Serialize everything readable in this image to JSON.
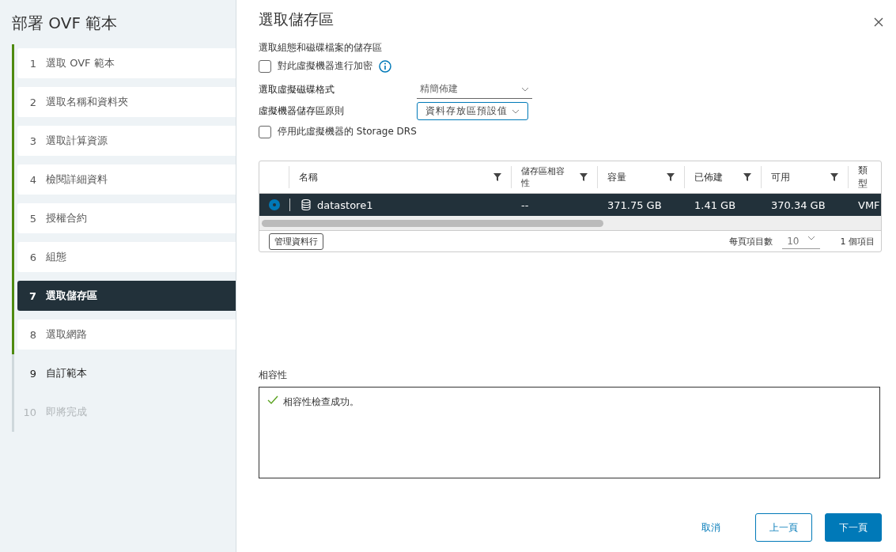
{
  "sidebar": {
    "title": "部署 OVF 範本",
    "steps": [
      {
        "number": "1",
        "label": "選取 OVF 範本",
        "completed": true,
        "selected": false,
        "disabled": false
      },
      {
        "number": "2",
        "label": "選取名稱和資料夾",
        "completed": true,
        "selected": false,
        "disabled": false
      },
      {
        "number": "3",
        "label": "選取計算資源",
        "completed": true,
        "selected": false,
        "disabled": false
      },
      {
        "number": "4",
        "label": "檢閱詳細資料",
        "completed": true,
        "selected": false,
        "disabled": false
      },
      {
        "number": "5",
        "label": "授權合約",
        "completed": true,
        "selected": false,
        "disabled": false
      },
      {
        "number": "6",
        "label": "組態",
        "completed": true,
        "selected": false,
        "disabled": false
      },
      {
        "number": "7",
        "label": "選取儲存區",
        "completed": true,
        "selected": true,
        "disabled": false
      },
      {
        "number": "8",
        "label": "選取網路",
        "completed": true,
        "selected": false,
        "disabled": false
      },
      {
        "number": "9",
        "label": "自訂範本",
        "completed": false,
        "selected": false,
        "disabled": false
      },
      {
        "number": "10",
        "label": "即將完成",
        "completed": false,
        "selected": false,
        "disabled": true
      }
    ]
  },
  "page": {
    "title": "選取儲存區",
    "subtitle": "選取組態和磁碟檔案的儲存區",
    "encrypt": {
      "label": "對此虛擬機器進行加密",
      "checked": false
    },
    "disk_format": {
      "label": "選取虛擬磁碟格式",
      "value": "精簡佈建"
    },
    "storage_policy": {
      "label": "虛擬機器儲存區原則",
      "value": "資料存放區預設值"
    },
    "disable_drs": {
      "label": "停用此虛擬機器的 Storage DRS",
      "checked": false
    }
  },
  "table": {
    "columns": [
      "名稱",
      "儲存區相容性",
      "容量",
      "已佈建",
      "可用",
      "類型"
    ],
    "rows": [
      {
        "selected": true,
        "cells": [
          "datastore1",
          "--",
          "371.75 GB",
          "1.41 GB",
          "370.34 GB",
          "VMF"
        ]
      }
    ],
    "manage_columns": "管理資料行",
    "per_page_label": "每頁項目數",
    "per_page": "10",
    "count": "1 個項目"
  },
  "compatibility": {
    "label": "相容性",
    "message": "相容性檢查成功。"
  },
  "buttons": {
    "cancel": "取消",
    "back": "上一頁",
    "next": "下一頁"
  }
}
